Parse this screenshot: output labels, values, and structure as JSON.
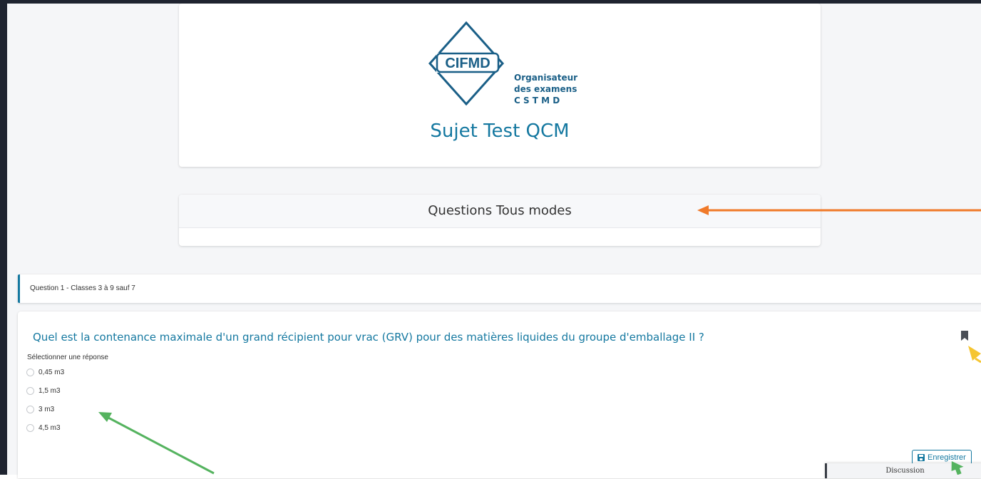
{
  "logo": {
    "acronym": "CIFMD",
    "tagline_1": "Organisateur",
    "tagline_2": "des examens",
    "tagline_3": "C S T M D"
  },
  "subject": {
    "title": "Sujet Test QCM"
  },
  "modes": {
    "title": "Questions Tous modes"
  },
  "question": {
    "header": "Question 1 - Classes 3 à 9 sauf 7",
    "text": "Quel est la contenance maximale d'un grand récipient pour vrac (GRV) pour des matières liquides du groupe d'emballage II ?",
    "select_label": "Sélectionner une réponse",
    "options": [
      {
        "label": "0,45 m3"
      },
      {
        "label": "1,5 m3"
      },
      {
        "label": "3 m3"
      },
      {
        "label": "4,5 m3"
      }
    ]
  },
  "actions": {
    "save_label": "Enregistrer"
  },
  "discussion": {
    "label": "Discussion"
  },
  "colors": {
    "brand": "#1478a0",
    "annotation_orange": "#f07a2a",
    "annotation_green": "#55b35f",
    "annotation_yellow": "#f5c531"
  },
  "icons": {
    "bookmark": "bookmark-icon",
    "save": "floppy-disk-icon"
  }
}
